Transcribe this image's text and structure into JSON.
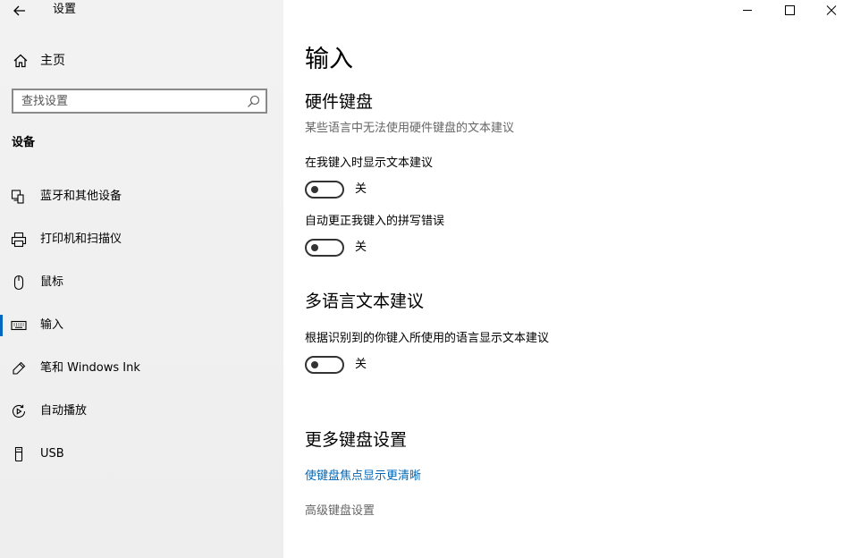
{
  "window": {
    "title": "设置",
    "controls": [
      "minimize-icon",
      "maximize-icon",
      "close-icon"
    ]
  },
  "sidebar": {
    "home_label": "主页",
    "search_placeholder": "查找设置",
    "section_title": "设备",
    "items": [
      {
        "label": "蓝牙和其他设备",
        "icon": "bluetooth-devices-icon",
        "active": false
      },
      {
        "label": "打印机和扫描仪",
        "icon": "printer-icon",
        "active": false
      },
      {
        "label": "鼠标",
        "icon": "mouse-icon",
        "active": false
      },
      {
        "label": "输入",
        "icon": "keyboard-icon",
        "active": true
      },
      {
        "label": "笔和 Windows Ink",
        "icon": "pen-icon",
        "active": false
      },
      {
        "label": "自动播放",
        "icon": "autoplay-icon",
        "active": false
      },
      {
        "label": "USB",
        "icon": "usb-icon",
        "active": false
      }
    ]
  },
  "main": {
    "title": "输入",
    "hardware_keyboard": {
      "heading": "硬件键盘",
      "description": "某些语言中无法使用硬件键盘的文本建议",
      "settings": [
        {
          "label": "在我键入时显示文本建议",
          "state": "关",
          "on": false
        },
        {
          "label": "自动更正我键入的拼写错误",
          "state": "关",
          "on": false
        }
      ]
    },
    "multilingual": {
      "heading": "多语言文本建议",
      "settings": [
        {
          "label": "根据识别到的你键入所使用的语言显示文本建议",
          "state": "关",
          "on": false
        }
      ]
    },
    "more_keyboard": {
      "heading": "更多键盘设置",
      "link_focus": "使键盘焦点显示更清晰",
      "link_advanced": "高级键盘设置"
    }
  },
  "colors": {
    "accent": "#0067c0",
    "link": "#0067b8",
    "sidebar_bg": "#f2f2f2"
  }
}
